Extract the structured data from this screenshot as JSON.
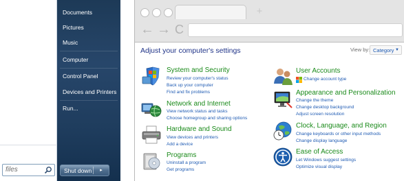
{
  "start_menu": {
    "items": [
      "Documents",
      "Pictures",
      "Music",
      "Computer",
      "Control Panel",
      "Devices and Printers",
      "Run..."
    ],
    "search_text": "files",
    "shutdown_label": "Shut down",
    "shutdown_arrow": "▸"
  },
  "browser": {
    "back_glyph": "←",
    "forward_glyph": "→",
    "refresh_glyph": "C",
    "new_tab_glyph": "+"
  },
  "control_panel": {
    "title": "Adjust your computer's settings",
    "view_by_label": "View by:",
    "view_by_value": "Category",
    "view_by_arrow": "▼",
    "categories": [
      {
        "title": "System and Security",
        "icon": "shield-icon",
        "links": [
          "Review your computer's status",
          "Back up your computer",
          "Find and fix problems"
        ]
      },
      {
        "title": "Network and Internet",
        "icon": "globe-network-icon",
        "links": [
          "View network status and tasks",
          "Choose homegroup and sharing options"
        ]
      },
      {
        "title": "Hardware and Sound",
        "icon": "printer-icon",
        "links": [
          "View devices and printers",
          "Add a device"
        ]
      },
      {
        "title": "Programs",
        "icon": "programs-icon",
        "links": [
          "Uninstall a program",
          "Get programs"
        ]
      },
      {
        "title": "User Accounts",
        "icon": "users-icon",
        "links": [
          "Change account type"
        ]
      },
      {
        "title": "Appearance and Personalization",
        "icon": "display-icon",
        "links": [
          "Change the theme",
          "Change desktop background",
          "Adjust screen resolution"
        ]
      },
      {
        "title": "Clock, Language, and Region",
        "icon": "clock-globe-icon",
        "links": [
          "Change keyboards or other input methods",
          "Change display language"
        ]
      },
      {
        "title": "Ease of Access",
        "icon": "ease-of-access-icon",
        "links": [
          "Let Windows suggest settings",
          "Optimize visual display"
        ]
      }
    ]
  }
}
